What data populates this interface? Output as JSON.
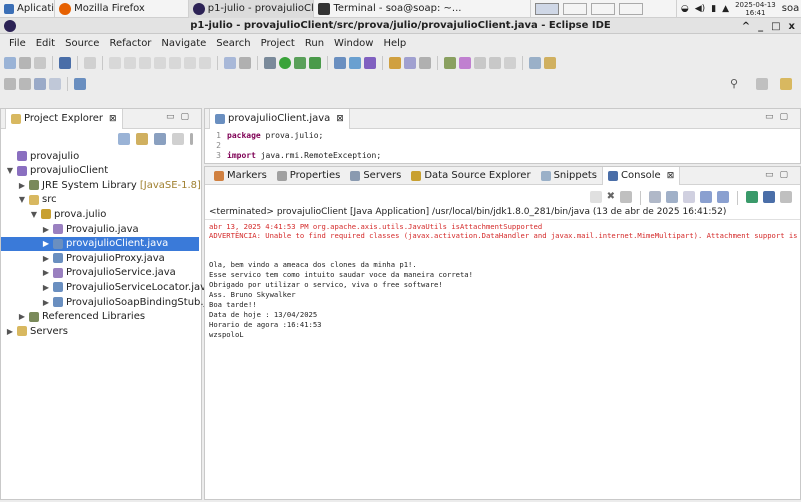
{
  "taskbar": {
    "apps_label": "Aplicativos",
    "tasks": [
      {
        "label": "Mozilla Firefox"
      },
      {
        "label": "p1-julio - provajulioClie..."
      },
      {
        "label": "Terminal - soa@soap: ~..."
      }
    ],
    "clock_date": "2025-04-13",
    "clock_time": "16:41",
    "user": "soa"
  },
  "window": {
    "title": "p1-julio - provajulioClient/src/prova/julio/provajulioClient.java - Eclipse IDE",
    "controls": [
      "^",
      "_",
      "□",
      "x"
    ]
  },
  "menu": [
    "File",
    "Edit",
    "Source",
    "Refactor",
    "Navigate",
    "Search",
    "Project",
    "Run",
    "Window",
    "Help"
  ],
  "project_explorer": {
    "tab_label": "Project Explorer",
    "tree": [
      {
        "label": "provajulio",
        "indent": 0,
        "twisty": "",
        "icon": "project-icon",
        "selected": false
      },
      {
        "label": "provajulioClient",
        "indent": 0,
        "twisty": "▼",
        "icon": "project-icon",
        "selected": false
      },
      {
        "label": "JRE System Library",
        "suffix": "[JavaSE-1.8]",
        "indent": 1,
        "twisty": "▶",
        "icon": "library-icon",
        "selected": false
      },
      {
        "label": "src",
        "indent": 1,
        "twisty": "▼",
        "icon": "folder-icon",
        "selected": false
      },
      {
        "label": "prova.julio",
        "indent": 2,
        "twisty": "▼",
        "icon": "package-icon",
        "selected": false
      },
      {
        "label": "Provajulio.java",
        "indent": 3,
        "twisty": "▶",
        "icon": "java-interface-icon",
        "selected": false
      },
      {
        "label": "provajulioClient.java",
        "indent": 3,
        "twisty": "▶",
        "icon": "java-file-icon",
        "selected": true
      },
      {
        "label": "ProvajulioProxy.java",
        "indent": 3,
        "twisty": "▶",
        "icon": "java-file-icon",
        "selected": false
      },
      {
        "label": "ProvajulioService.java",
        "indent": 3,
        "twisty": "▶",
        "icon": "java-interface-icon",
        "selected": false
      },
      {
        "label": "ProvajulioServiceLocator.java",
        "indent": 3,
        "twisty": "▶",
        "icon": "java-file-icon",
        "selected": false
      },
      {
        "label": "ProvajulioSoapBindingStub.java",
        "indent": 3,
        "twisty": "▶",
        "icon": "java-file-icon",
        "selected": false
      },
      {
        "label": "Referenced Libraries",
        "indent": 1,
        "twisty": "▶",
        "icon": "library-icon",
        "selected": false
      },
      {
        "label": "Servers",
        "indent": 0,
        "twisty": "▶",
        "icon": "folder-icon",
        "selected": false
      }
    ]
  },
  "editor": {
    "tab_label": "provajulioClient.java",
    "lines": [
      {
        "num": "1",
        "kw": "package",
        "rest": " prova.julio;"
      },
      {
        "num": "2",
        "kw": "",
        "rest": ""
      },
      {
        "num": "3",
        "kw": "import",
        "rest": " java.rmi.RemoteException;"
      }
    ]
  },
  "bottom_panel": {
    "tabs": [
      "Markers",
      "Properties",
      "Servers",
      "Data Source Explorer",
      "Snippets",
      "Console"
    ],
    "active_tab": "Console",
    "terminated_line": "<terminated> provajulioClient [Java Application] /usr/local/bin/jdk1.8.0_281/bin/java (13 de abr de 2025 16:41:52)",
    "log_lines": [
      "abr 13, 2025 4:41:53 PM org.apache.axis.utils.JavaUtils isAttachmentSupported",
      "ADVERTÊNCIA: Unable to find required classes (javax.activation.DataHandler and javax.mail.internet.MimeMultipart). Attachment support is disabled."
    ],
    "output_lines": [
      "Ola, bem vindo a ameaca dos clones da minha p1!.",
      "Esse servico tem como intuito saudar voce da maneira correta!",
      "Obrigado por utilizar o servico, viva o free software!",
      "Ass. Bruno Skywalker",
      "Boa tarde!!",
      "Data de hoje : 13/04/2025",
      "Horario de agora :16:41:53",
      "wzspoloL"
    ]
  },
  "colors": {
    "selection": "#3a7ad9",
    "log_red": "#d42a2a",
    "keyword": "#7f0055",
    "firefox": "#e66000",
    "eclipse": "#2c2255"
  }
}
